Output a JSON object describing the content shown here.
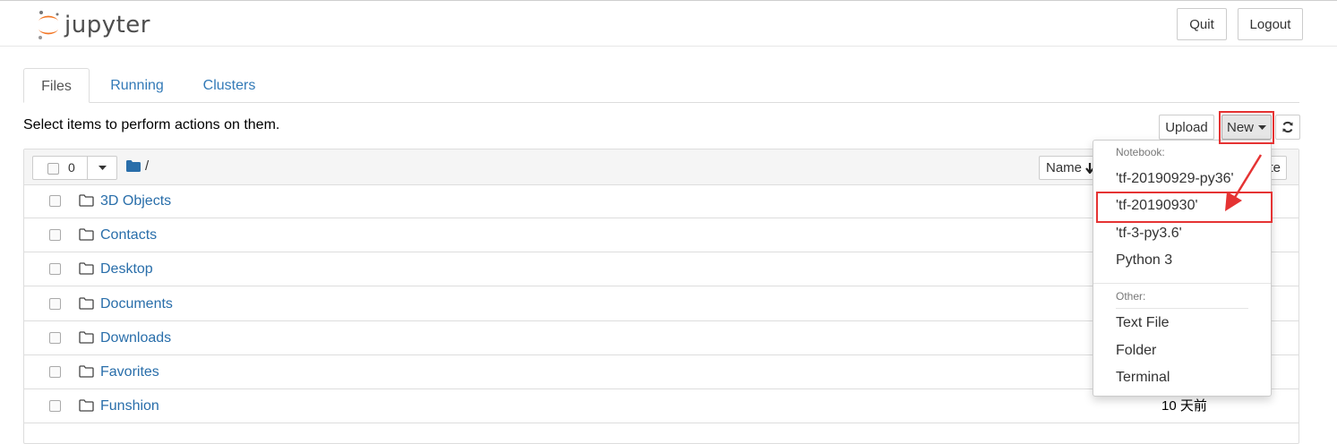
{
  "app": {
    "name": "jupyter"
  },
  "header": {
    "quit_label": "Quit",
    "logout_label": "Logout"
  },
  "tabs": [
    {
      "label": "Files",
      "active": true
    },
    {
      "label": "Running",
      "active": false
    },
    {
      "label": "Clusters",
      "active": false
    }
  ],
  "toolbar": {
    "hint": "Select items to perform actions on them.",
    "upload_label": "Upload",
    "new_label": "New",
    "refresh_icon": "refresh-icon"
  },
  "list_header": {
    "selected_count": "0",
    "path": "/",
    "sort_label": "Name",
    "last_modified_partial": "te"
  },
  "files": [
    {
      "name": "3D Objects",
      "type": "folder",
      "modified": ""
    },
    {
      "name": "Contacts",
      "type": "folder",
      "modified": ""
    },
    {
      "name": "Desktop",
      "type": "folder",
      "modified": ""
    },
    {
      "name": "Documents",
      "type": "folder",
      "modified": ""
    },
    {
      "name": "Downloads",
      "type": "folder",
      "modified": ""
    },
    {
      "name": "Favorites",
      "type": "folder",
      "modified": ""
    },
    {
      "name": "Funshion",
      "type": "folder",
      "modified": "10 天前"
    }
  ],
  "new_menu": {
    "notebook_header": "Notebook:",
    "notebook_items": [
      "'tf-20190929-py36'",
      "'tf-20190930'",
      "'tf-3-py3.6'",
      "Python 3"
    ],
    "other_header": "Other:",
    "other_items": [
      "Text File",
      "Folder",
      "Terminal"
    ],
    "highlighted_item": "'tf-20190930'"
  },
  "colors": {
    "link": "#296eaa",
    "annotation": "#e53333",
    "logo_orange": "#f37726"
  }
}
